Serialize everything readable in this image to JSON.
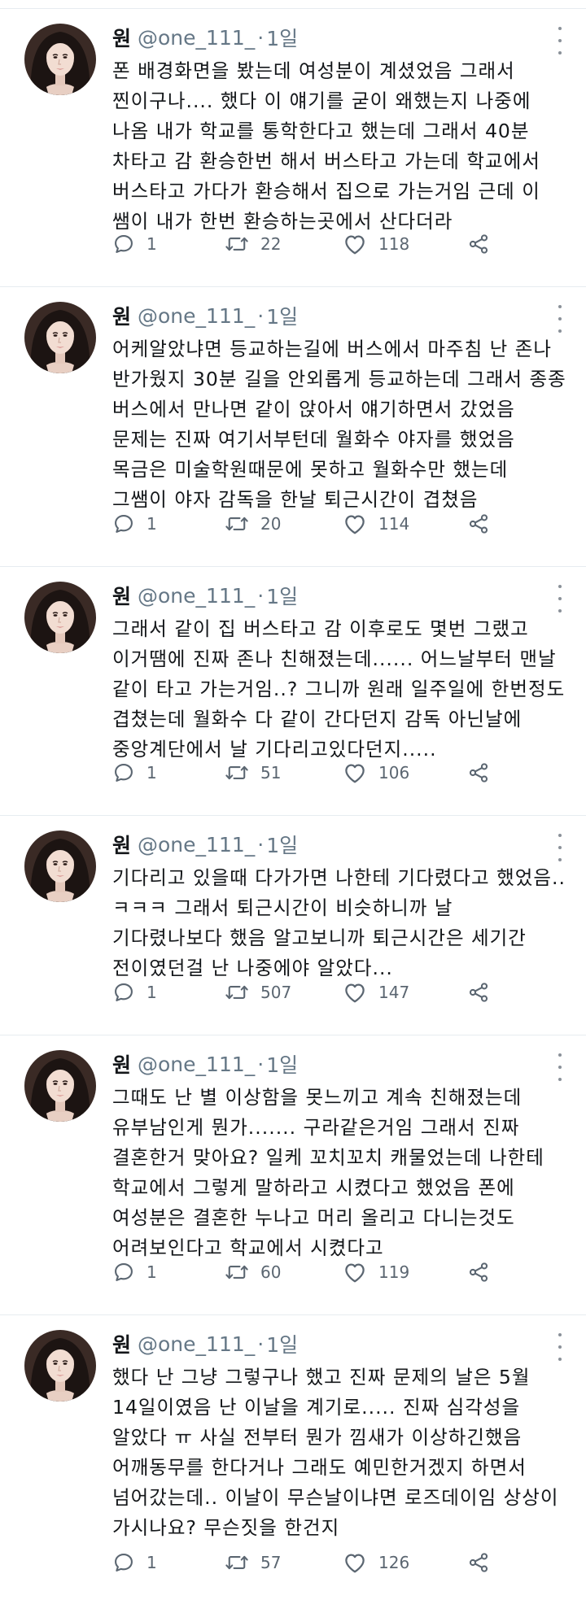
{
  "feed": {
    "tweets": [
      {
        "display_name": "원",
        "handle": "@one_111_",
        "separator": "·",
        "time": "1일",
        "lines": [
          "폰 배경화면을 봤는데 여성분이 계셨었음 그래서",
          "찐이구나.... 했다 이 얘기를 굳이 왜했는지 나중에",
          "나옴 내가 학교를 통학한다고 했는데 그래서 40분",
          "차타고 감 환승한번 해서 버스타고 가는데 학교에서",
          "버스타고 가다가 환승해서 집으로 가는거임 근데 이",
          "쌤이 내가 한번 환승하는곳에서 산다더라"
        ],
        "replies": "1",
        "retweets": "22",
        "likes": "118"
      },
      {
        "display_name": "원",
        "handle": "@one_111_",
        "separator": "·",
        "time": "1일",
        "lines": [
          "어케알았냐면 등교하는길에 버스에서 마주침 난 존나",
          "반가웠지 30분 길을 안외롭게 등교하는데 그래서 종종",
          "버스에서 만나면 같이 앉아서 얘기하면서 갔었음",
          "문제는 진짜 여기서부턴데 월화수 야자를 했었음",
          "목금은 미술학원때문에 못하고 월화수만 했는데",
          "그쌤이 야자 감독을 한날 퇴근시간이 겹쳤음"
        ],
        "replies": "1",
        "retweets": "20",
        "likes": "114"
      },
      {
        "display_name": "원",
        "handle": "@one_111_",
        "separator": "·",
        "time": "1일",
        "lines": [
          "그래서 같이 집 버스타고 감 이후로도 몇번 그랬고",
          "이거땜에 진짜 존나 친해졌는데...... 어느날부터 맨날",
          "같이 타고 가는거임..? 그니까 원래 일주일에 한번정도",
          "겹쳤는데 월화수 다 같이 간다던지 감독 아닌날에",
          "중앙계단에서 날 기다리고있다던지....."
        ],
        "replies": "1",
        "retweets": "51",
        "likes": "106"
      },
      {
        "display_name": "원",
        "handle": "@one_111_",
        "separator": "·",
        "time": "1일",
        "lines": [
          "기다리고 있을때 다가가면 나한테 기다렸다고 했었음..",
          "ㅋㅋㅋ 그래서 퇴근시간이 비슷하니까 날",
          "기다렸나보다 했음 알고보니까 퇴근시간은 세기간",
          "전이였던걸 난 나중에야 알았다..."
        ],
        "replies": "1",
        "retweets": "507",
        "likes": "147"
      },
      {
        "display_name": "원",
        "handle": "@one_111_",
        "separator": "·",
        "time": "1일",
        "lines": [
          "그때도 난 별 이상함을 못느끼고 계속 친해졌는데",
          "유부남인게 뭔가....... 구라같은거임 그래서 진짜",
          "결혼한거 맞아요? 일케 꼬치꼬치 캐물었는데 나한테",
          "학교에서 그렇게 말하라고 시켰다고 했었음 폰에",
          "여성분은 결혼한 누나고 머리 올리고 다니는것도",
          "어려보인다고 학교에서 시켰다고"
        ],
        "replies": "1",
        "retweets": "60",
        "likes": "119"
      },
      {
        "display_name": "원",
        "handle": "@one_111_",
        "separator": "·",
        "time": "1일",
        "lines": [
          "했다 난 그냥 그렇구나 했고 진짜 문제의 날은 5월",
          "14일이였음 난 이날을 계기로..... 진짜 심각성을",
          "알았다 ㅠ 사실 전부터 뭔가 낌새가 이상하긴했음",
          "어깨동무를 한다거나 그래도 예민한거겠지 하면서",
          "넘어갔는데.. 이날이 무슨날이냐면 로즈데이임 상상이",
          "가시나요? 무슨짓을 한건지"
        ],
        "replies": "1",
        "retweets": "57",
        "likes": "126"
      }
    ]
  },
  "icons": {
    "reply": "reply-icon",
    "retweet": "retweet-icon",
    "like": "heart-icon",
    "share": "share-icon",
    "more": "more-vertical-icon"
  },
  "colors": {
    "text": "#14171a",
    "meta": "#657786",
    "icon": "#5b6671",
    "divider": "#e6ecf0"
  }
}
